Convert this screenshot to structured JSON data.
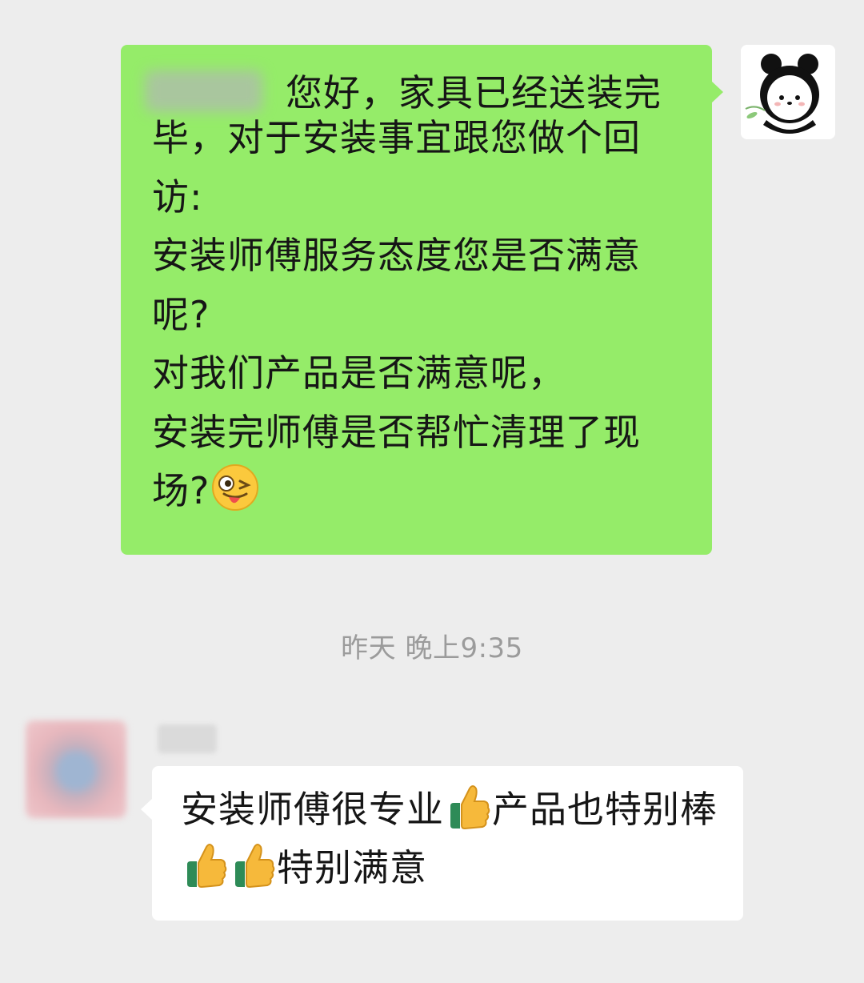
{
  "chat": {
    "outgoing": {
      "sender_blurred": true,
      "line1": "您好，家具已经送装完",
      "body": "毕，对于安装事宜跟您做个回访:\n安装师傅服务态度您是否满意呢?\n对我们产品是否满意呢，\n安装完师傅是否帮忙清理了现场?",
      "emoji": "winking-face-with-tongue",
      "bubble_color": "#95ec69"
    },
    "timestamp": "昨天 晚上9:35",
    "incoming": {
      "sender_blurred": true,
      "text_part1": "安装师傅很专业",
      "text_part2": "产品也特别棒",
      "text_part3": "特别满意",
      "emoji": "thumbs-up",
      "bubble_color": "#ffffff"
    }
  },
  "colors": {
    "background": "#ededed",
    "timestamp": "#9b9b9b"
  }
}
